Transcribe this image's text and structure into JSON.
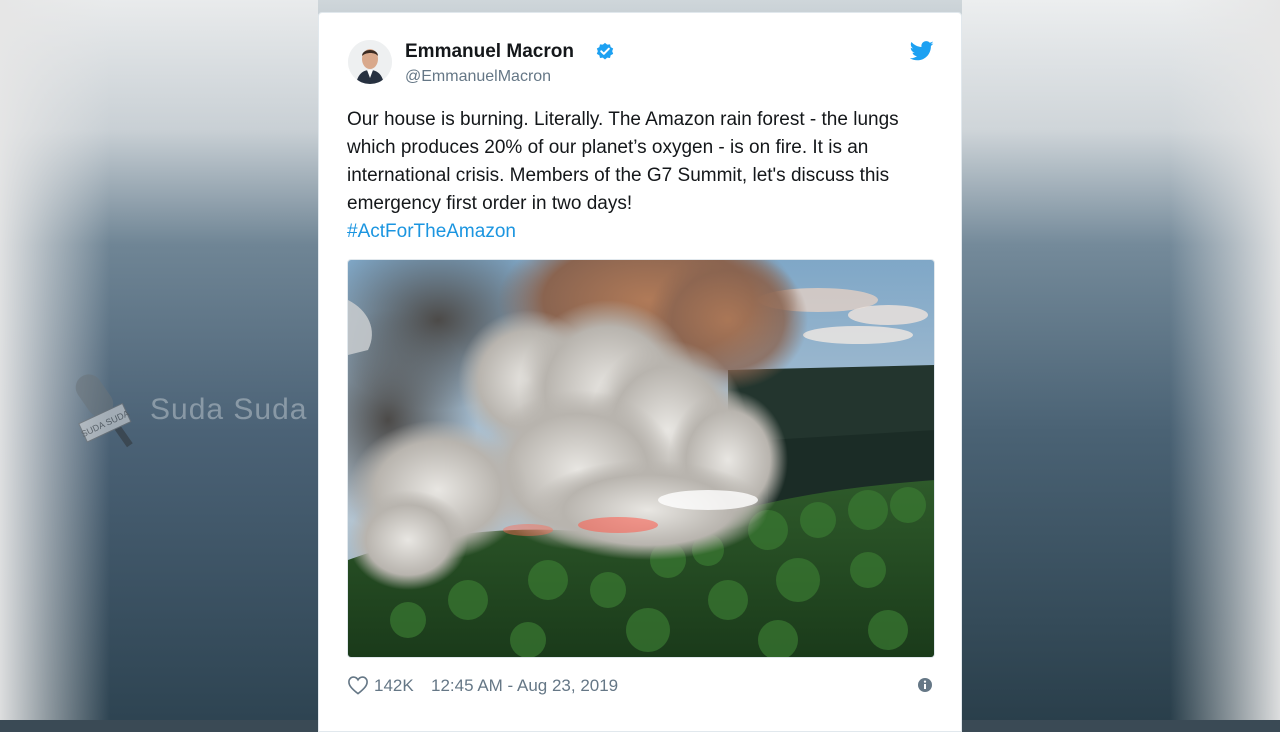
{
  "tweet": {
    "author_name": "Emmanuel Macron",
    "author_handle": "@EmmanuelMacron",
    "text": "Our house is burning. Literally. The Amazon rain forest - the lungs which produces 20% of our planet’s oxygen - is on fire. It is an international crisis. Members of the G7 Summit, let's discuss this emergency first order in two days!",
    "hashtag": "#ActForTheAmazon",
    "likes": "142K",
    "timestamp": "12:45 AM - Aug 23, 2019"
  },
  "watermark": {
    "text": "Suda Suda",
    "badge_text": "SUDA SUDA"
  },
  "icons": {
    "verified": "verified-badge-icon",
    "bird": "twitter-bird-icon",
    "heart": "heart-icon",
    "info": "info-icon"
  },
  "colors": {
    "link": "#1b95e0",
    "twitter_blue": "#1da1f2",
    "secondary_text": "#657786",
    "primary_text": "#14171a"
  }
}
